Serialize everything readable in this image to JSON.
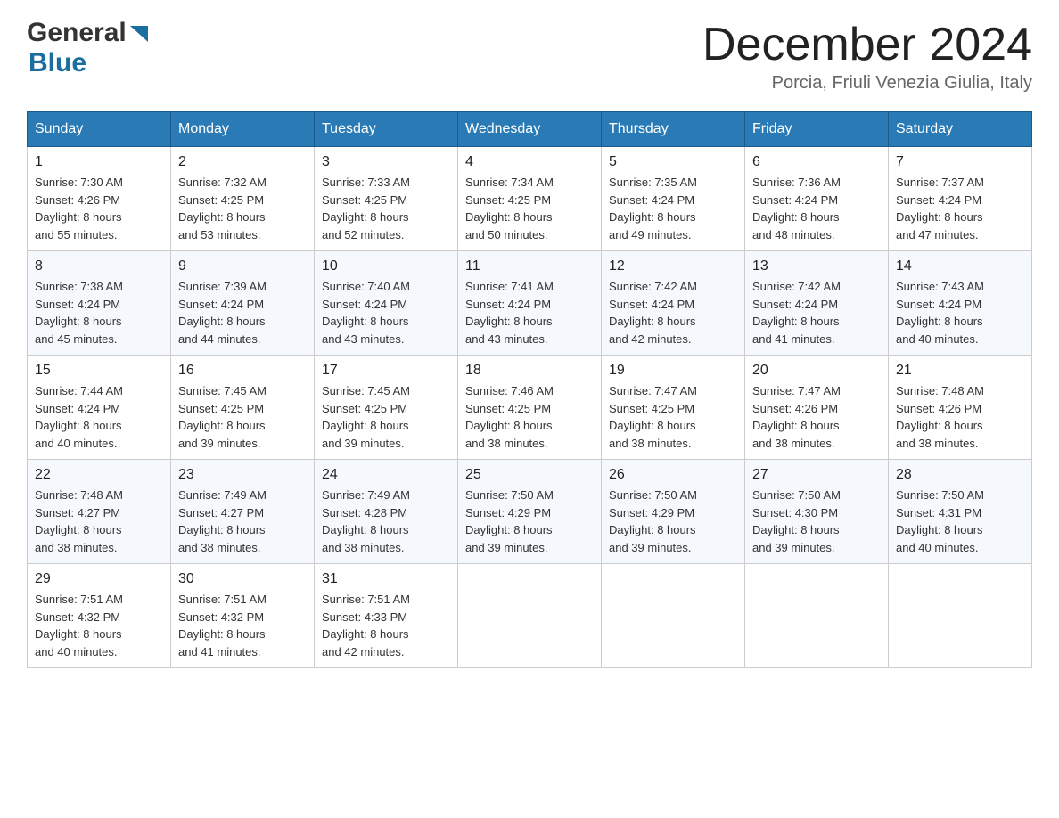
{
  "header": {
    "logo_general": "General",
    "logo_blue": "Blue",
    "month_title": "December 2024",
    "location": "Porcia, Friuli Venezia Giulia, Italy"
  },
  "days_of_week": [
    "Sunday",
    "Monday",
    "Tuesday",
    "Wednesday",
    "Thursday",
    "Friday",
    "Saturday"
  ],
  "weeks": [
    [
      {
        "day": "1",
        "sunrise": "7:30 AM",
        "sunset": "4:26 PM",
        "daylight": "8 hours and 55 minutes."
      },
      {
        "day": "2",
        "sunrise": "7:32 AM",
        "sunset": "4:25 PM",
        "daylight": "8 hours and 53 minutes."
      },
      {
        "day": "3",
        "sunrise": "7:33 AM",
        "sunset": "4:25 PM",
        "daylight": "8 hours and 52 minutes."
      },
      {
        "day": "4",
        "sunrise": "7:34 AM",
        "sunset": "4:25 PM",
        "daylight": "8 hours and 50 minutes."
      },
      {
        "day": "5",
        "sunrise": "7:35 AM",
        "sunset": "4:24 PM",
        "daylight": "8 hours and 49 minutes."
      },
      {
        "day": "6",
        "sunrise": "7:36 AM",
        "sunset": "4:24 PM",
        "daylight": "8 hours and 48 minutes."
      },
      {
        "day": "7",
        "sunrise": "7:37 AM",
        "sunset": "4:24 PM",
        "daylight": "8 hours and 47 minutes."
      }
    ],
    [
      {
        "day": "8",
        "sunrise": "7:38 AM",
        "sunset": "4:24 PM",
        "daylight": "8 hours and 45 minutes."
      },
      {
        "day": "9",
        "sunrise": "7:39 AM",
        "sunset": "4:24 PM",
        "daylight": "8 hours and 44 minutes."
      },
      {
        "day": "10",
        "sunrise": "7:40 AM",
        "sunset": "4:24 PM",
        "daylight": "8 hours and 43 minutes."
      },
      {
        "day": "11",
        "sunrise": "7:41 AM",
        "sunset": "4:24 PM",
        "daylight": "8 hours and 43 minutes."
      },
      {
        "day": "12",
        "sunrise": "7:42 AM",
        "sunset": "4:24 PM",
        "daylight": "8 hours and 42 minutes."
      },
      {
        "day": "13",
        "sunrise": "7:42 AM",
        "sunset": "4:24 PM",
        "daylight": "8 hours and 41 minutes."
      },
      {
        "day": "14",
        "sunrise": "7:43 AM",
        "sunset": "4:24 PM",
        "daylight": "8 hours and 40 minutes."
      }
    ],
    [
      {
        "day": "15",
        "sunrise": "7:44 AM",
        "sunset": "4:24 PM",
        "daylight": "8 hours and 40 minutes."
      },
      {
        "day": "16",
        "sunrise": "7:45 AM",
        "sunset": "4:25 PM",
        "daylight": "8 hours and 39 minutes."
      },
      {
        "day": "17",
        "sunrise": "7:45 AM",
        "sunset": "4:25 PM",
        "daylight": "8 hours and 39 minutes."
      },
      {
        "day": "18",
        "sunrise": "7:46 AM",
        "sunset": "4:25 PM",
        "daylight": "8 hours and 38 minutes."
      },
      {
        "day": "19",
        "sunrise": "7:47 AM",
        "sunset": "4:25 PM",
        "daylight": "8 hours and 38 minutes."
      },
      {
        "day": "20",
        "sunrise": "7:47 AM",
        "sunset": "4:26 PM",
        "daylight": "8 hours and 38 minutes."
      },
      {
        "day": "21",
        "sunrise": "7:48 AM",
        "sunset": "4:26 PM",
        "daylight": "8 hours and 38 minutes."
      }
    ],
    [
      {
        "day": "22",
        "sunrise": "7:48 AM",
        "sunset": "4:27 PM",
        "daylight": "8 hours and 38 minutes."
      },
      {
        "day": "23",
        "sunrise": "7:49 AM",
        "sunset": "4:27 PM",
        "daylight": "8 hours and 38 minutes."
      },
      {
        "day": "24",
        "sunrise": "7:49 AM",
        "sunset": "4:28 PM",
        "daylight": "8 hours and 38 minutes."
      },
      {
        "day": "25",
        "sunrise": "7:50 AM",
        "sunset": "4:29 PM",
        "daylight": "8 hours and 39 minutes."
      },
      {
        "day": "26",
        "sunrise": "7:50 AM",
        "sunset": "4:29 PM",
        "daylight": "8 hours and 39 minutes."
      },
      {
        "day": "27",
        "sunrise": "7:50 AM",
        "sunset": "4:30 PM",
        "daylight": "8 hours and 39 minutes."
      },
      {
        "day": "28",
        "sunrise": "7:50 AM",
        "sunset": "4:31 PM",
        "daylight": "8 hours and 40 minutes."
      }
    ],
    [
      {
        "day": "29",
        "sunrise": "7:51 AM",
        "sunset": "4:32 PM",
        "daylight": "8 hours and 40 minutes."
      },
      {
        "day": "30",
        "sunrise": "7:51 AM",
        "sunset": "4:32 PM",
        "daylight": "8 hours and 41 minutes."
      },
      {
        "day": "31",
        "sunrise": "7:51 AM",
        "sunset": "4:33 PM",
        "daylight": "8 hours and 42 minutes."
      },
      null,
      null,
      null,
      null
    ]
  ],
  "labels": {
    "sunrise": "Sunrise:",
    "sunset": "Sunset:",
    "daylight": "Daylight:"
  }
}
